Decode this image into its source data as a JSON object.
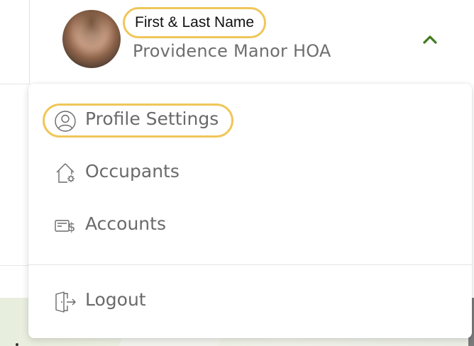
{
  "user": {
    "name": "First & Last Name",
    "organization": "Providence Manor HOA"
  },
  "menu": {
    "items": [
      {
        "label": "Profile Settings",
        "icon": "user-circle-icon"
      },
      {
        "label": "Occupants",
        "icon": "house-gear-icon"
      },
      {
        "label": "Accounts",
        "icon": "bill-dollar-icon"
      }
    ],
    "logout": {
      "label": "Logout",
      "icon": "logout-door-icon"
    }
  },
  "colors": {
    "highlight": "#f0c65a",
    "caret": "#3f7a1e",
    "label": "#6a6a6a",
    "org_name": "#6e6e6e"
  }
}
